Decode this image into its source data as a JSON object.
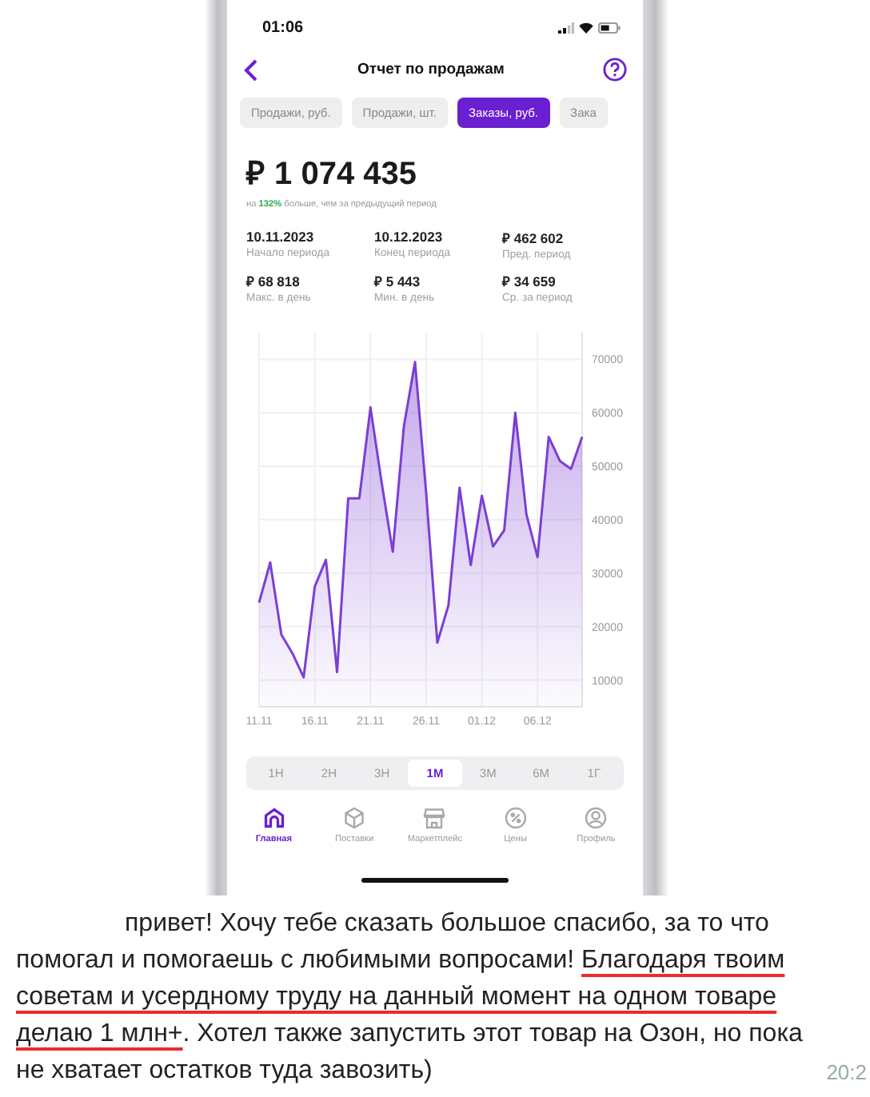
{
  "phone": {
    "status_bar": {
      "time": "01:06"
    },
    "header": {
      "title": "Отчет по продажам"
    },
    "tabs": [
      {
        "label": "Продажи, руб.",
        "selected": false
      },
      {
        "label": "Продажи, шт.",
        "selected": false
      },
      {
        "label": "Заказы, руб.",
        "selected": true
      },
      {
        "label": "Зака",
        "selected": false
      }
    ],
    "total": "₽ 1 074 435",
    "comparison": {
      "prefix": "на",
      "percent": "132%",
      "suffix": "больше, чем за предыдущий период"
    },
    "stats": [
      {
        "value": "10.11.2023",
        "label": "Начало периода"
      },
      {
        "value": "10.12.2023",
        "label": "Конец периода"
      },
      {
        "value": "₽  462 602",
        "label": "Пред. период"
      },
      {
        "value": "₽ 68 818",
        "label": "Макс. в день"
      },
      {
        "value": "₽ 5 443",
        "label": "Мин. в день"
      },
      {
        "value": "₽ 34 659",
        "label": "Ср. за период"
      }
    ],
    "chart_data": {
      "type": "area",
      "categories": [
        "11.11",
        null,
        null,
        null,
        null,
        "16.11",
        null,
        null,
        null,
        null,
        "21.11",
        null,
        null,
        null,
        null,
        "26.11",
        null,
        null,
        null,
        null,
        "01.12",
        null,
        null,
        null,
        null,
        "06.12",
        null,
        null,
        null,
        null
      ],
      "series": [
        {
          "color": "#7b3fd4",
          "values": [
            24500,
            32000,
            18500,
            15000,
            10500,
            27500,
            32500,
            11500,
            44000,
            44000,
            61000,
            47000,
            34000,
            57500,
            69500,
            45000,
            17000,
            24000,
            46000,
            31500,
            44500,
            35000,
            38000,
            60000,
            41000,
            33000,
            55500,
            51000,
            49500,
            55500
          ]
        }
      ],
      "yticks": [
        10000,
        20000,
        30000,
        40000,
        50000,
        60000,
        70000
      ],
      "ylim": [
        5000,
        75000
      ],
      "grid": true
    },
    "ranges": [
      {
        "label": "1Н",
        "selected": false
      },
      {
        "label": "2Н",
        "selected": false
      },
      {
        "label": "3Н",
        "selected": false
      },
      {
        "label": "1М",
        "selected": true
      },
      {
        "label": "3М",
        "selected": false
      },
      {
        "label": "6М",
        "selected": false
      },
      {
        "label": "1Г",
        "selected": false
      }
    ],
    "nav": [
      {
        "kind": "home",
        "label": "Главная",
        "selected": true
      },
      {
        "kind": "box",
        "label": "Поставки",
        "selected": false
      },
      {
        "kind": "store",
        "label": "Маркетплейс",
        "selected": false
      },
      {
        "kind": "percent",
        "label": "Цены",
        "selected": false
      },
      {
        "kind": "profile",
        "label": "Профиль",
        "selected": false
      }
    ]
  },
  "message": {
    "segments": [
      {
        "text": "привет! Хочу тебе сказать большое спасибо, за то что помогал и помогаешь с любимыми вопросами! ",
        "underlined": false
      },
      {
        "text": "Благодаря твоим советам и усердному труду на данный момент на одном товаре делаю 1 млн+",
        "underlined": true
      },
      {
        "text": ". Хотел также запустить этот товар на Озон, но пока не хватает остатков туда завозить)",
        "underlined": false
      }
    ],
    "time": "20:2"
  }
}
